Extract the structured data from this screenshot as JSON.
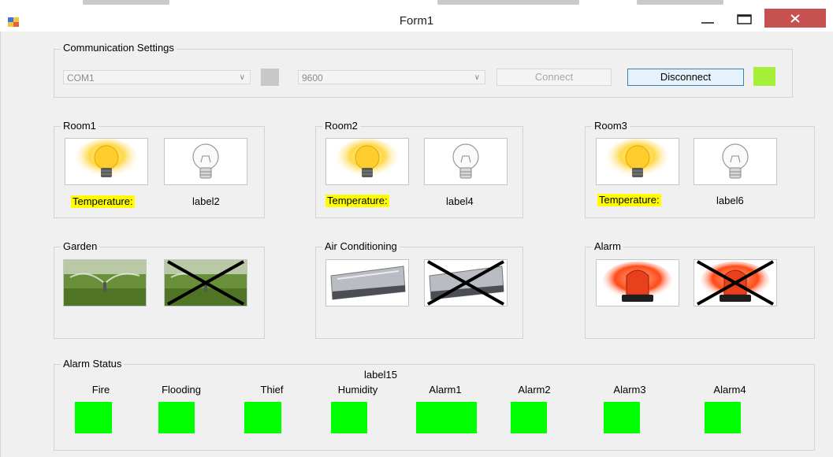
{
  "window": {
    "title": "Form1"
  },
  "colors": {
    "indicator_green": "#00ff00",
    "connected_green": "#a6f03a",
    "highlight_yellow": "#ffff00",
    "close_red": "#c75050"
  },
  "communication": {
    "group_label": "Communication Settings",
    "port_value": "COM1",
    "baud_value": "9600",
    "connect_label": "Connect",
    "disconnect_label": "Disconnect"
  },
  "rooms": [
    {
      "label": "Room1",
      "temp_label": "Temperature:",
      "value_label": "label2"
    },
    {
      "label": "Room2",
      "temp_label": "Temperature:",
      "value_label": "label4"
    },
    {
      "label": "Room3",
      "temp_label": "Temperature:",
      "value_label": "label6"
    }
  ],
  "devices": [
    {
      "label": "Garden",
      "icon": "sprinkler-icon"
    },
    {
      "label": "Air Conditioning",
      "icon": "air-conditioner-icon"
    },
    {
      "label": "Alarm",
      "icon": "siren-icon"
    }
  ],
  "alarm_status": {
    "group_label": "Alarm Status",
    "center_label": "label15",
    "items": [
      "Fire",
      "Flooding",
      "Thief",
      "Humidity",
      "Alarm1",
      "Alarm2",
      "Alarm3",
      "Alarm4"
    ]
  }
}
